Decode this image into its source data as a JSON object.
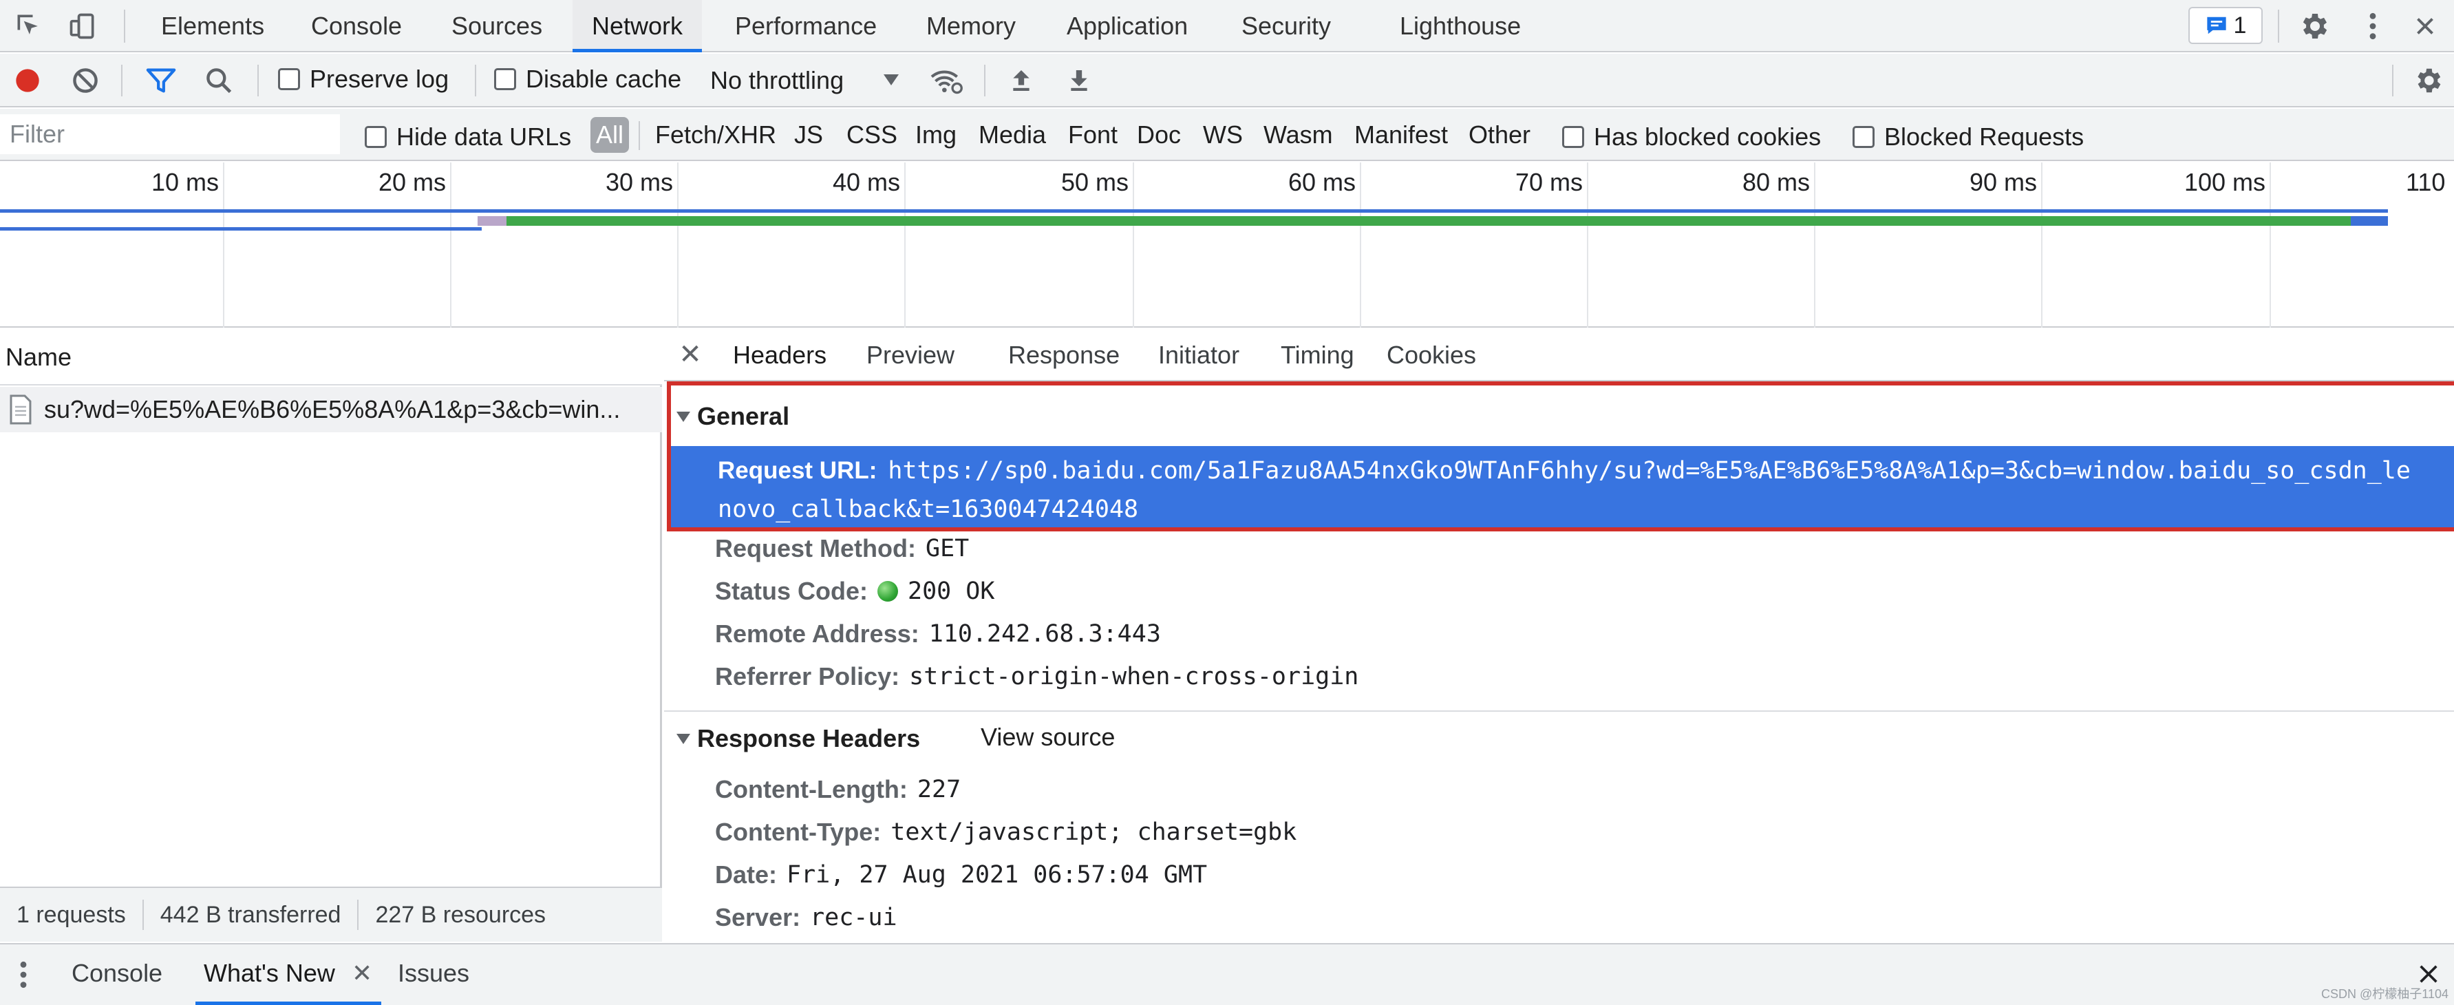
{
  "main_tabs": [
    {
      "label": "Elements"
    },
    {
      "label": "Console"
    },
    {
      "label": "Sources"
    },
    {
      "label": "Network"
    },
    {
      "label": "Performance"
    },
    {
      "label": "Memory"
    },
    {
      "label": "Application"
    },
    {
      "label": "Security"
    },
    {
      "label": "Lighthouse"
    }
  ],
  "active_main_tab": "Network",
  "issues_badge": {
    "count": "1"
  },
  "toolbar": {
    "preserve_log": "Preserve log",
    "disable_cache": "Disable cache",
    "throttling": "No throttling"
  },
  "filter": {
    "placeholder": "Filter",
    "hide_data_urls": "Hide data URLs",
    "types": [
      "All",
      "Fetch/XHR",
      "JS",
      "CSS",
      "Img",
      "Media",
      "Font",
      "Doc",
      "WS",
      "Wasm",
      "Manifest",
      "Other"
    ],
    "active_type": "All",
    "has_blocked_cookies": "Has blocked cookies",
    "blocked_requests": "Blocked Requests"
  },
  "timeline": {
    "ticks": [
      "10 ms",
      "20 ms",
      "30 ms",
      "40 ms",
      "50 ms",
      "60 ms",
      "70 ms",
      "80 ms",
      "90 ms",
      "100 ms",
      "110"
    ]
  },
  "request_list": {
    "header": "Name",
    "rows": [
      {
        "name": "su?wd=%E5%AE%B6%E5%8A%A1&p=3&cb=win..."
      }
    ]
  },
  "summary": {
    "requests": "1 requests",
    "transferred": "442 B transferred",
    "resources": "227 B resources"
  },
  "detail_tabs": [
    "Headers",
    "Preview",
    "Response",
    "Initiator",
    "Timing",
    "Cookies"
  ],
  "active_detail_tab": "Headers",
  "general": {
    "title": "General",
    "request_url_key": "Request URL:",
    "request_url_line1": "https://sp0.baidu.com/5a1Fazu8AA54nxGko9WTAnF6hhy/su?wd=%E5%AE%B6%E5%8A%A1&p=3&cb=window.baidu_so_csdn_le",
    "request_url_line2": "novo_callback&t=1630047424048",
    "request_method_key": "Request Method:",
    "request_method": "GET",
    "status_code_key": "Status Code:",
    "status_code": "200 OK",
    "remote_address_key": "Remote Address:",
    "remote_address": "110.242.68.3:443",
    "referrer_policy_key": "Referrer Policy:",
    "referrer_policy": "strict-origin-when-cross-origin"
  },
  "response_headers": {
    "title": "Response Headers",
    "view_source": "View source",
    "items": [
      {
        "key": "Content-Length:",
        "value": "227"
      },
      {
        "key": "Content-Type:",
        "value": "text/javascript; charset=gbk"
      },
      {
        "key": "Date:",
        "value": "Fri, 27 Aug 2021 06:57:04 GMT"
      },
      {
        "key": "Server:",
        "value": "rec-ui"
      }
    ]
  },
  "drawer_tabs": [
    {
      "label": "Console"
    },
    {
      "label": "What's New"
    },
    {
      "label": "Issues"
    }
  ],
  "active_drawer_tab": "What's New",
  "watermark": "CSDN @柠檬柚子1104",
  "colors": {
    "accent": "#1a73e8",
    "record": "#d93025",
    "selection": "#3874e0",
    "highlight_frame": "#d1302b"
  }
}
